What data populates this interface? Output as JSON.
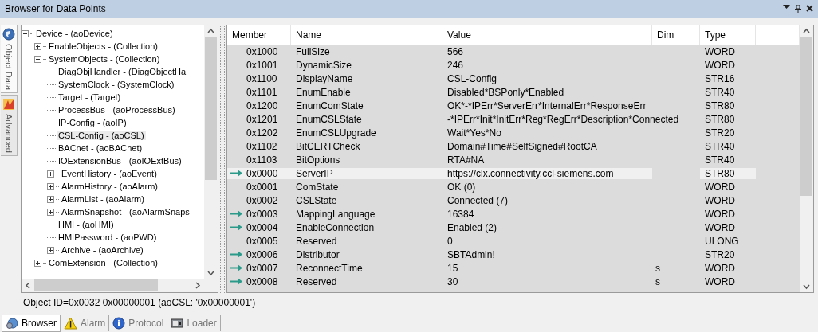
{
  "window": {
    "title": "Browser for Data Points"
  },
  "side_tabs": [
    {
      "label": "Object Data",
      "selected": true,
      "kind": "globe"
    },
    {
      "label": "Advanced",
      "selected": false,
      "kind": "warning"
    }
  ],
  "tree": [
    {
      "label": "Device - (aoDevice)",
      "expanded": true,
      "selected": false,
      "children": [
        {
          "label": "EnableObjects - (Collection)",
          "expanded": false,
          "selected": false
        },
        {
          "label": "SystemObjects - (Collection)",
          "expanded": true,
          "selected": false,
          "children": [
            {
              "label": "DiagObjHandler - (DiagObjectHa",
              "selected": false
            },
            {
              "label": "SystemClock - (SystemClock)",
              "selected": false
            },
            {
              "label": "Target - (Target)",
              "selected": false
            },
            {
              "label": "ProcessBus - (aoProcessBus)",
              "selected": false
            },
            {
              "label": "IP-Config - (aoIP)",
              "selected": false
            },
            {
              "label": "CSL-Config - (aoCSL)",
              "selected": true
            },
            {
              "label": "BACnet - (aoBACnet)",
              "selected": false
            },
            {
              "label": "IOExtensionBus - (aoIOExtBus)",
              "selected": false
            },
            {
              "label": "EventHistory - (aoEvent)",
              "expanded": false,
              "selected": false
            },
            {
              "label": "AlarmHistory - (aoAlarm)",
              "expanded": false,
              "selected": false
            },
            {
              "label": "AlarmList - (aoAlarm)",
              "expanded": false,
              "selected": false
            },
            {
              "label": "AlarmSnapshot - (aoAlarmSnaps",
              "expanded": false,
              "selected": false
            },
            {
              "label": "HMI - (aoHMI)",
              "selected": false
            },
            {
              "label": "HMIPassword - (aoPWD)",
              "selected": false
            },
            {
              "label": "Archive - (aoArchive)",
              "expanded": false,
              "selected": false
            }
          ]
        },
        {
          "label": "ComExtension - (Collection)",
          "expanded": false,
          "selected": false
        }
      ]
    }
  ],
  "table": {
    "columns": [
      "Member",
      "Name",
      "Value",
      "Dim",
      "Type"
    ],
    "rows": [
      {
        "member": "0x1000",
        "name": "FullSize",
        "value": "566",
        "type": "WORD",
        "arrow": false,
        "selected": false
      },
      {
        "member": "0x1001",
        "name": "DynamicSize",
        "value": "246",
        "type": "WORD",
        "arrow": false,
        "selected": false
      },
      {
        "member": "0x1100",
        "name": "DisplayName",
        "value": "CSL-Config",
        "type": "STR16",
        "arrow": false,
        "selected": false
      },
      {
        "member": "0x1101",
        "name": "EnumEnable",
        "value": "Disabled*BSPonly*Enabled",
        "type": "STR40",
        "arrow": false,
        "selected": false
      },
      {
        "member": "0x1200",
        "name": "EnumComState",
        "value": "OK*-*IPErr*ServerErr*InternalErr*ResponseErr",
        "type": "STR80",
        "arrow": false,
        "selected": false
      },
      {
        "member": "0x1201",
        "name": "EnumCSLState",
        "value": "-*IPErr*Init*InitErr*Reg*RegErr*Description*Connected",
        "type": "STR80",
        "arrow": false,
        "selected": false
      },
      {
        "member": "0x1202",
        "name": "EnumCSLUpgrade",
        "value": "Wait*Yes*No",
        "type": "STR20",
        "arrow": false,
        "selected": false
      },
      {
        "member": "0x1102",
        "name": "BitCERTCheck",
        "value": "Domain#Time#SelfSigned#RootCA",
        "type": "STR40",
        "arrow": false,
        "selected": false
      },
      {
        "member": "0x1103",
        "name": "BitOptions",
        "value": "RTA#NA",
        "type": "STR40",
        "arrow": false,
        "selected": false
      },
      {
        "member": "0x0000",
        "name": "ServerIP",
        "value": "https://clx.connectivity.ccl-siemens.com",
        "type": "STR80",
        "arrow": true,
        "selected": true
      },
      {
        "member": "0x0001",
        "name": "ComState",
        "value": "OK (0)",
        "type": "WORD",
        "arrow": false,
        "selected": false
      },
      {
        "member": "0x0002",
        "name": "CSLState",
        "value": "Connected (7)",
        "type": "WORD",
        "arrow": false,
        "selected": false
      },
      {
        "member": "0x0003",
        "name": "MappingLanguage",
        "value": "16384",
        "type": "WORD",
        "arrow": true,
        "selected": false
      },
      {
        "member": "0x0004",
        "name": "EnableConnection",
        "value": "Enabled (2)",
        "type": "WORD",
        "arrow": true,
        "selected": false
      },
      {
        "member": "0x0005",
        "name": "Reserved",
        "value": "0",
        "type": "ULONG",
        "arrow": false,
        "selected": false
      },
      {
        "member": "0x0006",
        "name": "Distributor",
        "value": "SBTAdmin!",
        "type": "STR20",
        "arrow": true,
        "selected": false
      },
      {
        "member": "0x0007",
        "name": "ReconnectTime",
        "value": "15",
        "dim": "s",
        "type": "WORD",
        "arrow": true,
        "selected": false
      },
      {
        "member": "0x0008",
        "name": "Reserved",
        "value": "30",
        "dim": "s",
        "type": "WORD",
        "arrow": true,
        "selected": false
      }
    ]
  },
  "status_bar": "Object ID=0x0032 0x00000001 (aoCSL: '0x00000001')",
  "bottom_tabs": [
    {
      "label": "Browser",
      "selected": true,
      "kind": "browser"
    },
    {
      "label": "Alarm",
      "selected": false,
      "kind": "alarm"
    },
    {
      "label": "Protocol",
      "selected": false,
      "kind": "info"
    },
    {
      "label": "Loader",
      "selected": false,
      "kind": "loader"
    }
  ]
}
